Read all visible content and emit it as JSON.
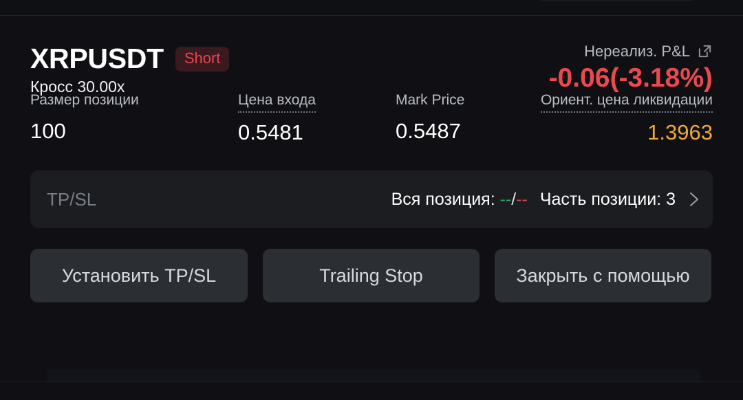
{
  "position": {
    "symbol": "XRPUSDT",
    "side_badge": "Short",
    "margin_mode_leverage": "Кросс 30.00x",
    "pnl_label": "Нереализ. P&L",
    "pnl_value": "-0.06(-3.18%)",
    "pnl_color": "#ea4a4f",
    "external_link_icon": "external-link-icon"
  },
  "stats": [
    {
      "label": "Размер позиции",
      "value": "100",
      "dotted": false,
      "color": "#ffffff"
    },
    {
      "label": "Цена входа",
      "value": "0.5481",
      "dotted": true,
      "color": "#ffffff"
    },
    {
      "label": "Mark Price",
      "value": "0.5487",
      "dotted": false,
      "color": "#ffffff"
    },
    {
      "label": "Ориент. цена ликвидации",
      "value": "1.3963",
      "dotted": true,
      "color": "#edaa36"
    }
  ],
  "tpsl": {
    "label": "TP/SL",
    "whole_position_label": "Вся позиция:",
    "tp_placeholder": "--",
    "separator": "/",
    "sl_placeholder": "--",
    "partial_position_label": "Часть позиции:",
    "partial_position_value": "3",
    "chevron_icon": "chevron-right-icon",
    "tp_color": "#2fae6a",
    "sl_color": "#e0484d"
  },
  "actions": {
    "set_tpsl": "Установить TP/SL",
    "trailing_stop": "Trailing Stop",
    "close_with": "Закрыть с помощью"
  }
}
